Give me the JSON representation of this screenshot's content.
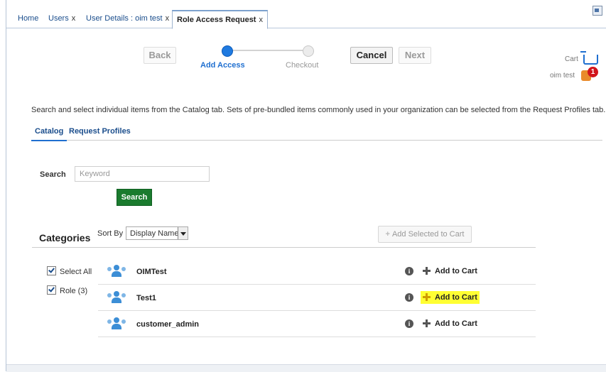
{
  "tabs": [
    {
      "label": "Home",
      "closable": false
    },
    {
      "label": "Users",
      "closable": true
    },
    {
      "label": "User Details : oim test",
      "closable": true
    },
    {
      "label": "Role Access Request",
      "closable": true,
      "active": true
    }
  ],
  "close_glyph": "x",
  "train": {
    "back_label": "Back",
    "cancel_label": "Cancel",
    "next_label": "Next",
    "step1_label": "Add Access",
    "step2_label": "Checkout"
  },
  "cart": {
    "label": "Cart",
    "user": "oim test",
    "count": "1"
  },
  "intro_text": "Search and select individual items from the Catalog tab. Sets of pre-bundled items commonly used in your organization can be selected from the Request Profiles tab.",
  "subtabs": [
    "Catalog",
    "Request Profiles"
  ],
  "search": {
    "label": "Search",
    "placeholder": "Keyword",
    "button_label": "Search"
  },
  "categories": {
    "title": "Categories",
    "sortby_label": "Sort By",
    "sort_value": "Display Name",
    "add_selected_label": "Add Selected to Cart",
    "filters": [
      {
        "label": "Select All",
        "checked": true
      },
      {
        "label": "Role (3)",
        "checked": true
      }
    ]
  },
  "items": [
    {
      "name": "OIMTest",
      "action": "Add to Cart",
      "highlighted": false
    },
    {
      "name": "Test1",
      "action": "Add to Cart",
      "highlighted": true
    },
    {
      "name": "customer_admin",
      "action": "Add to Cart",
      "highlighted": false
    }
  ],
  "colors": {
    "accent": "#1f7ae0",
    "search_button": "#1a7b2e",
    "badge": "#d1141b",
    "highlight": "#ffff33"
  }
}
